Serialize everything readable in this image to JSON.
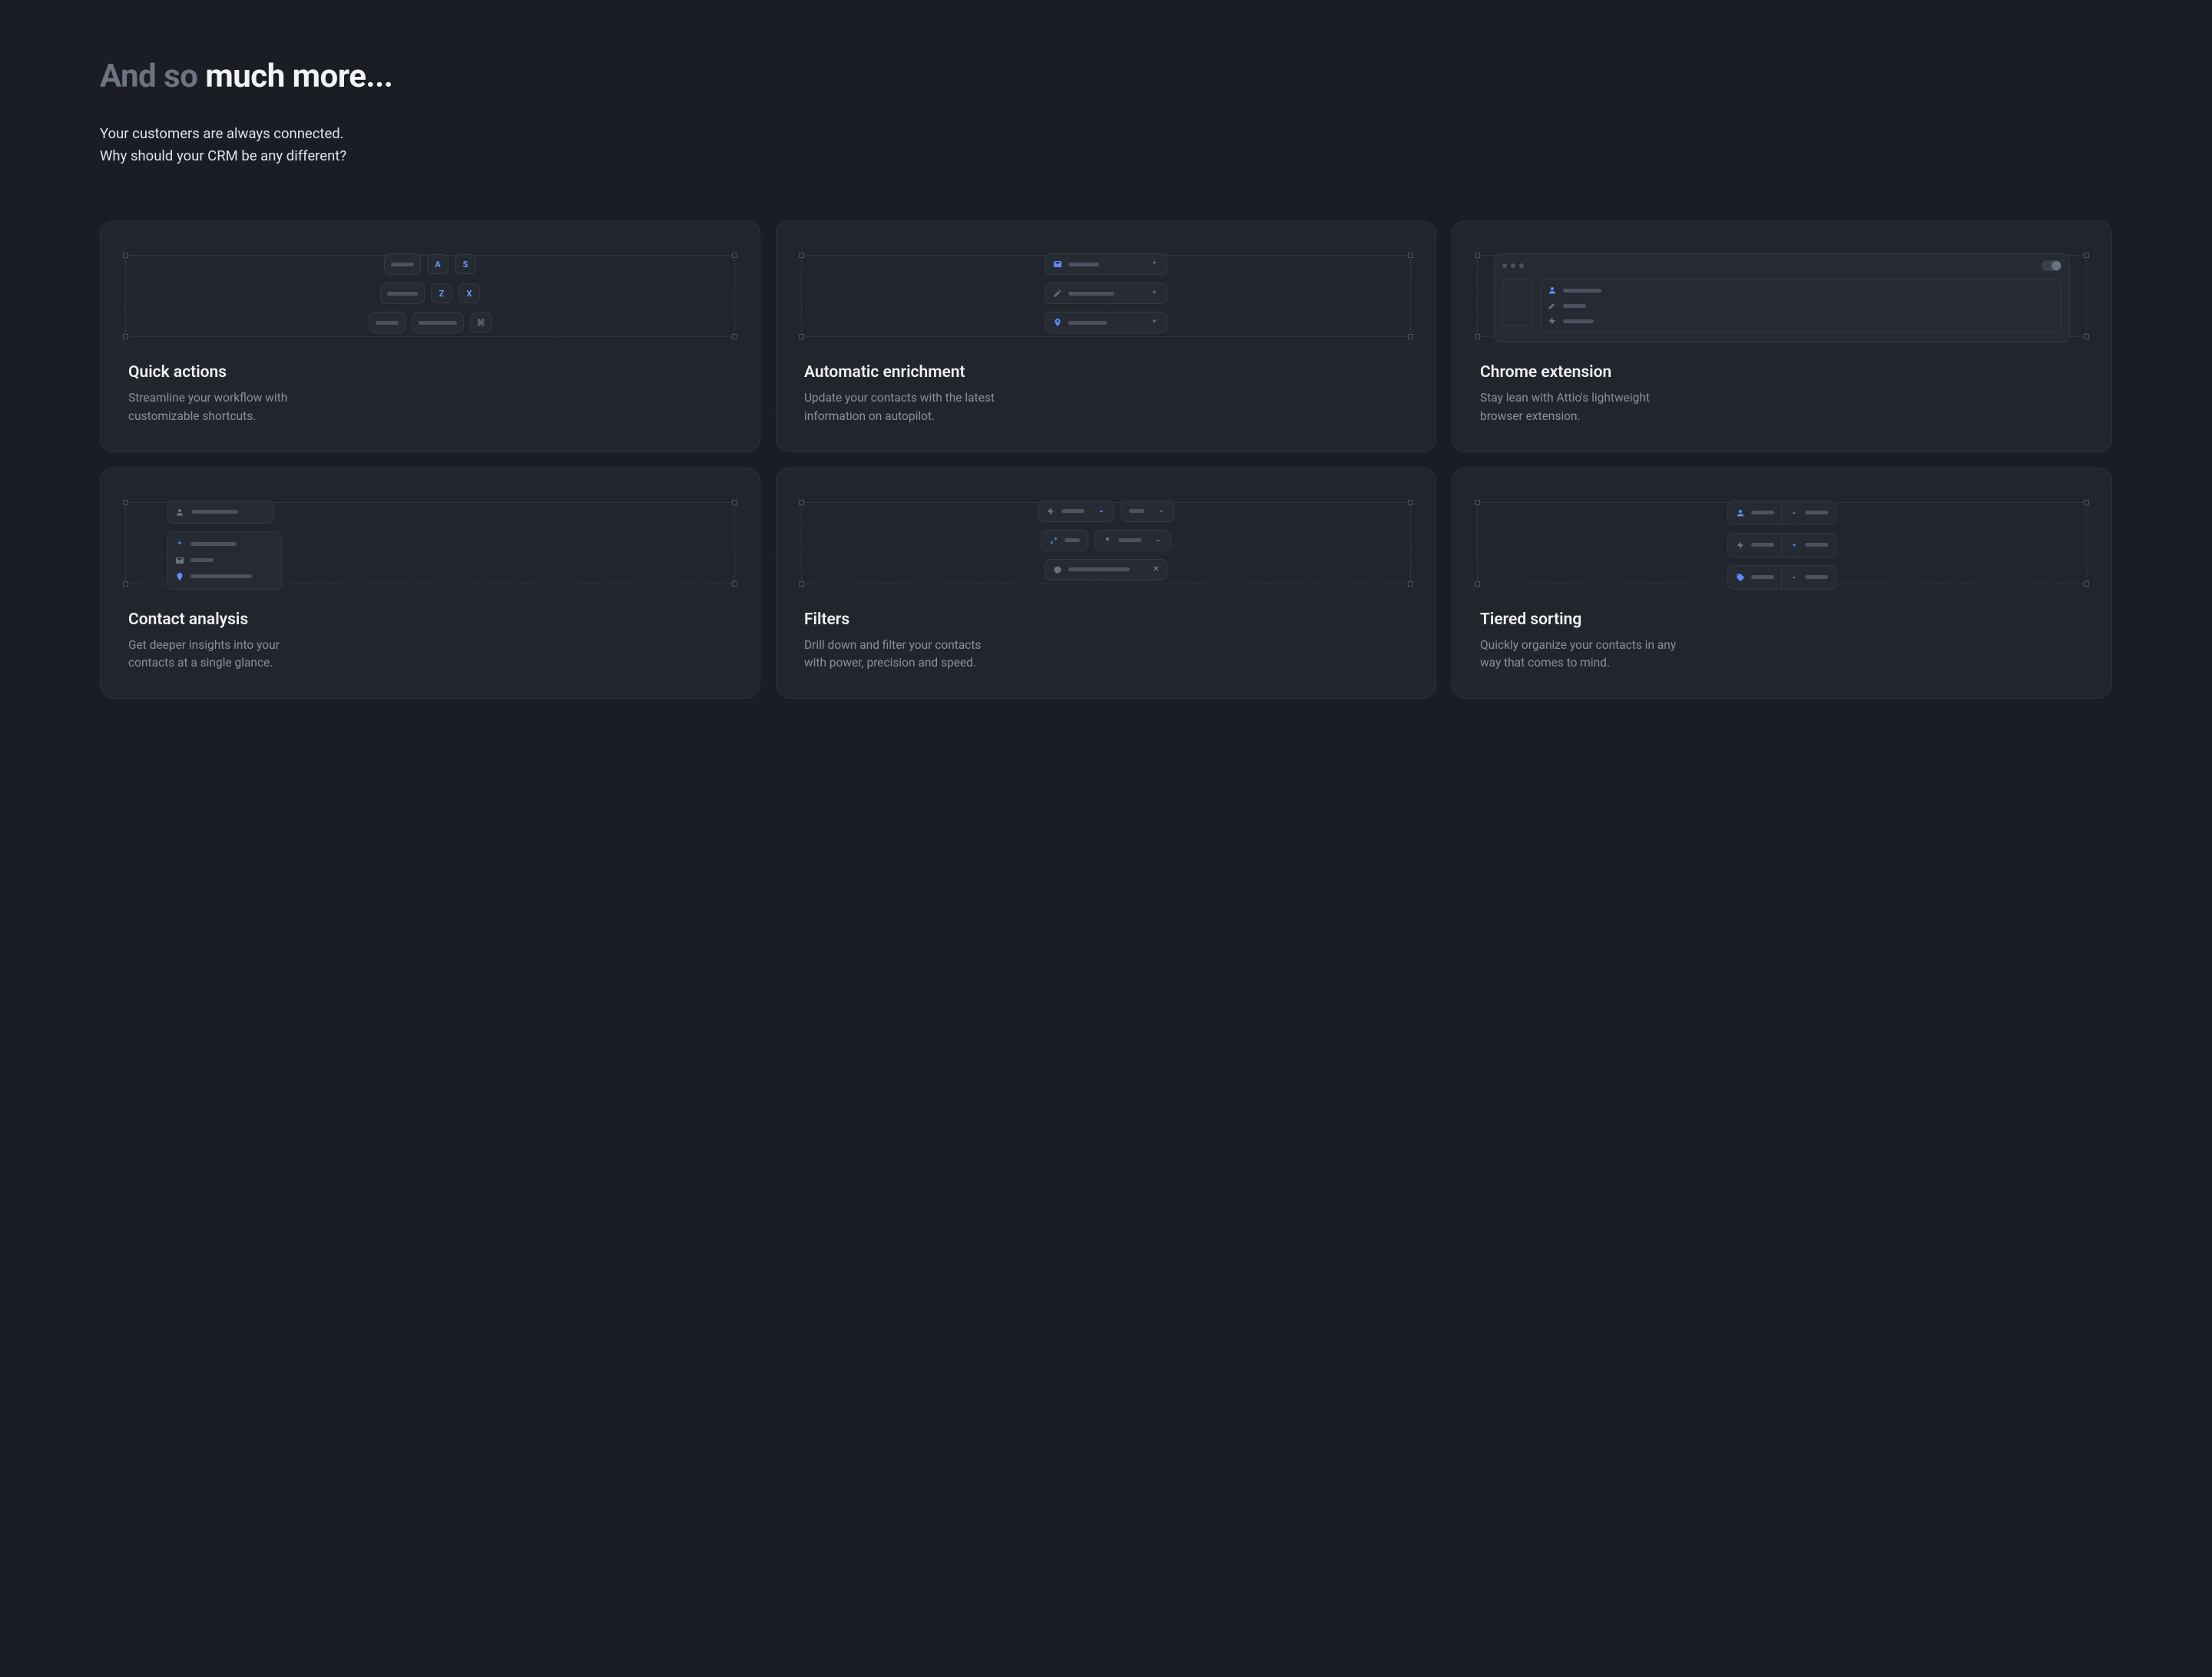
{
  "hero": {
    "title_muted": "And so ",
    "title_loud": "much more...",
    "subtitle_line1": "Your customers are always connected.",
    "subtitle_line2": "Why should your CRM be any different?"
  },
  "cards": {
    "quick_actions": {
      "title": "Quick actions",
      "desc": "Streamline your workflow with customizable shortcuts.",
      "keys": {
        "a": "A",
        "s": "S",
        "z": "Z",
        "x": "X",
        "cmd": "⌘"
      }
    },
    "automatic_enrichment": {
      "title": "Automatic enrichment",
      "desc": "Update your contacts with the latest information on autopilot."
    },
    "chrome_extension": {
      "title": "Chrome extension",
      "desc": "Stay lean with Attio's lightweight browser extension."
    },
    "contact_analysis": {
      "title": "Contact analysis",
      "desc": "Get deeper insights into your contacts at a single glance."
    },
    "filters": {
      "title": "Filters",
      "desc": "Drill down and filter your contacts with power, precision and speed."
    },
    "tiered_sorting": {
      "title": "Tiered sorting",
      "desc": "Quickly organize your contacts in any way that comes to mind."
    }
  }
}
